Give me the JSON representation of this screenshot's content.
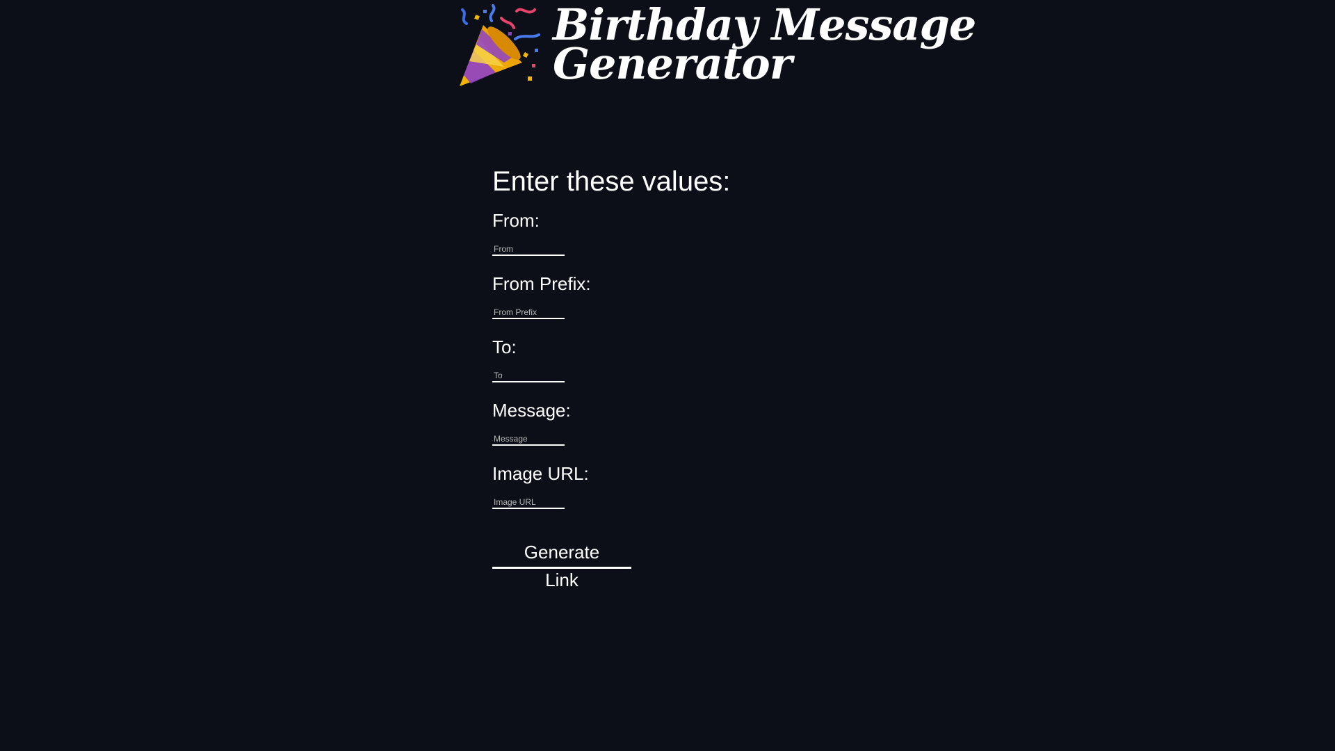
{
  "header": {
    "icon": "party-popper-icon",
    "title_line1": "Birthday Message",
    "title_line2": "Generator"
  },
  "form": {
    "heading": "Enter these values:",
    "fields": [
      {
        "label": "From:",
        "placeholder": "From",
        "value": ""
      },
      {
        "label": "From Prefix:",
        "placeholder": "From Prefix",
        "value": ""
      },
      {
        "label": "To:",
        "placeholder": "To",
        "value": ""
      },
      {
        "label": "Message:",
        "placeholder": "Message",
        "value": ""
      },
      {
        "label": "Image URL:",
        "placeholder": "Image URL",
        "value": ""
      }
    ],
    "submit_label": "Generate Link"
  },
  "colors": {
    "background": "#0c0f17",
    "text": "#ffffff"
  }
}
